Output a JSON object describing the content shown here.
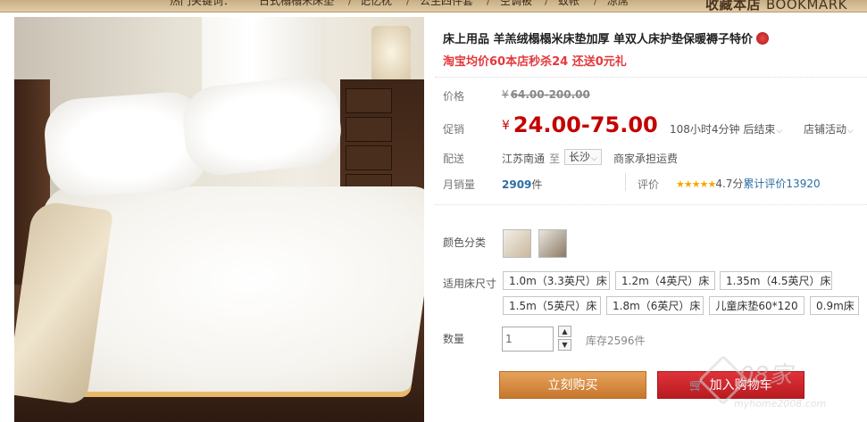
{
  "topnav": {
    "items": [
      "热门关键词：",
      "日式榻榻米床垫",
      "记忆枕",
      "公主四件套",
      "空调被",
      "蚊帐",
      "凉席"
    ],
    "bookmark_cn": "收藏本店",
    "bookmark_en": "BOOKMARK"
  },
  "product": {
    "title": "床上用品 羊羔绒榻榻米床垫加厚 单双人床护垫保暖褥子特价",
    "promo": "淘宝均价60本店秒杀24 还送0元礼",
    "image_icon": "bed-mattress-photo"
  },
  "price": {
    "label": "价格",
    "currency": "¥",
    "original": "64.00-200.00",
    "promo_label": "促销",
    "promo_price": "24.00-75.00",
    "countdown": "108小时4分钟 后结束",
    "store_event": "店铺活动"
  },
  "shipping": {
    "label": "配送",
    "from": "江苏南通",
    "to_label": "至",
    "to": "长沙",
    "fee": "商家承担运费"
  },
  "sales": {
    "label": "月销量",
    "count": "2909",
    "unit": "件",
    "rating_label": "评价",
    "stars": "★★★★★",
    "score": "4.7分",
    "total_label": "累计评价",
    "total": "13920"
  },
  "options": {
    "color_label": "颜色分类",
    "size_label": "适用床尺寸",
    "sizes": [
      "1.0m（3.3英尺）床",
      "1.2m（4英尺）床",
      "1.35m（4.5英尺）床",
      "1.5m（5英尺）床",
      "1.8m（6英尺）床",
      "儿童床垫60*120",
      "0.9m床"
    ]
  },
  "quantity": {
    "label": "数量",
    "value": "1",
    "stock": "库存2596件"
  },
  "actions": {
    "buy_now": "立刻购买",
    "add_cart": "加入购物车"
  },
  "watermark": {
    "big": "08家",
    "small": "myhome2008.com"
  },
  "colors": {
    "price_red": "#c40000",
    "buy_orange": "#d8893f",
    "cart_red": "#c9242a",
    "topbar_tan": "#d4bc93"
  }
}
